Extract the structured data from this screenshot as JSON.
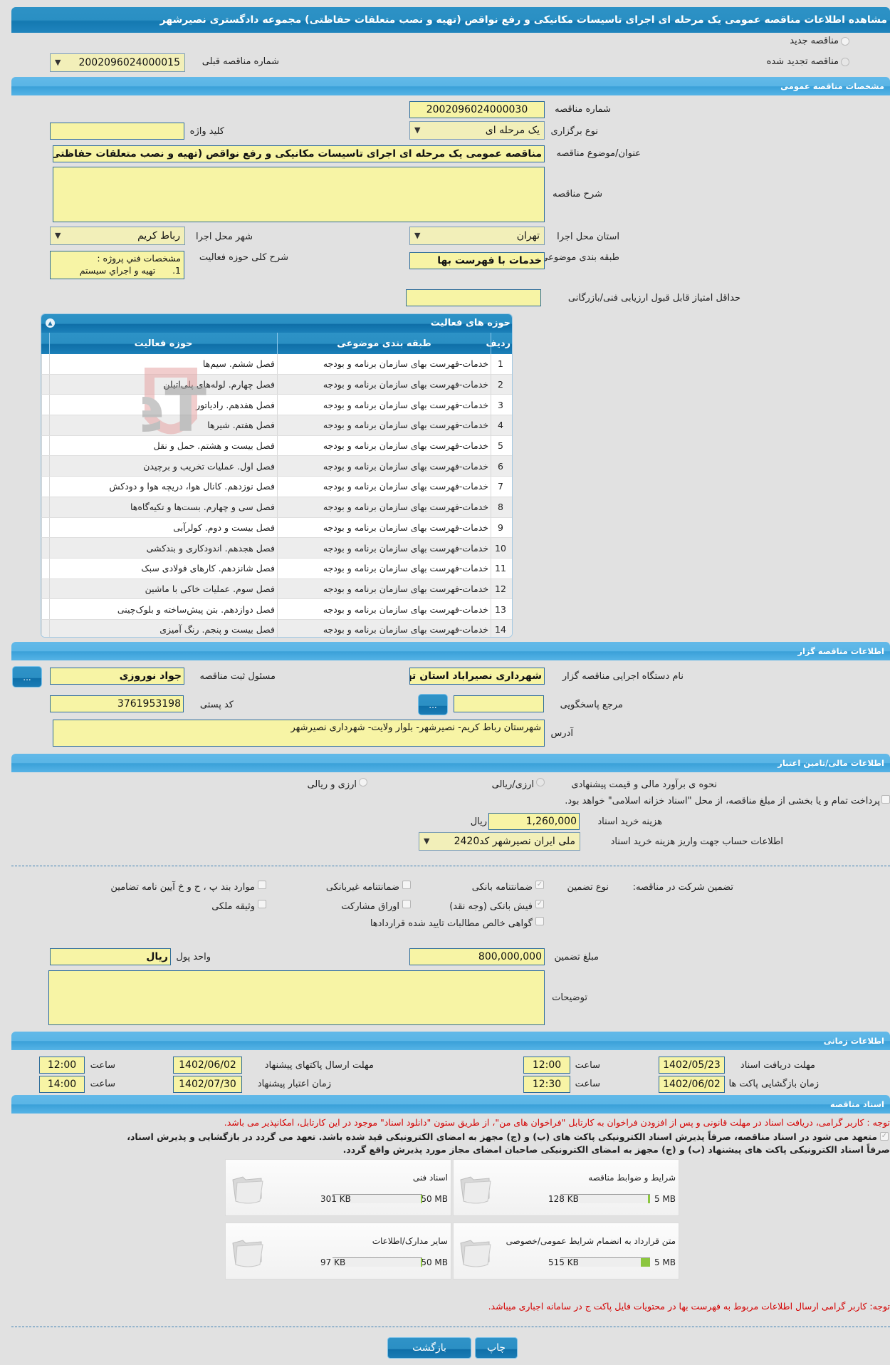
{
  "title": "مشاهده اطلاعات مناقصه عمومی یک مرحله ای اجرای تاسیسات مکانیکی و رفع نواقص (تهیه و نصب متعلقات حفاظتی) مجموعه دادگستری نصیرشهر",
  "tender_type": {
    "new_label": "مناقصه جدید",
    "renewed_label": "مناقصه تجدید شده",
    "previous_number_label": "شماره مناقصه قبلی",
    "previous_number_value": "2002096024000015"
  },
  "general": {
    "section_title": "مشخصات مناقصه عمومی",
    "number_label": "شماره مناقصه",
    "number_value": "2002096024000030",
    "holding_type_label": "نوع برگزاری",
    "holding_type_value": "یک مرحله ای",
    "keyword_label": "کلید واژه",
    "keyword_value": "",
    "subject_label": "عنوان/موضوع مناقصه",
    "subject_value": "مناقصه عمومی یک مرحله ای اجرای تاسیسات مکانیکی و رفع نواقص (تهیه و نصب متعلقات حفاظتی",
    "description_label": "شرح مناقصه",
    "description_value": "",
    "province_label": "استان محل اجرا",
    "province_value": "تهران",
    "city_label": "شهر محل اجرا",
    "city_value": "رباط کریم",
    "category_label": "طبقه بندی موضوعی",
    "category_value": "خدمات با فهرست بها",
    "activity_desc_label": "شرح کلی حوزه فعالیت",
    "activity_desc_line1": "مشخصات فني پروژه :",
    "activity_desc_line2": "1.      تهيه و اجراي سيستم",
    "min_score_label": "حداقل امتیاز قابل قبول ارزیابی فنی/بازرگانی",
    "min_score_value": ""
  },
  "activities": {
    "title": "حوزه های فعالیت",
    "columns": [
      "ردیف",
      "طبقه بندی موضوعی",
      "حوزه فعالیت"
    ],
    "rows": [
      {
        "idx": "1",
        "category": "خدمات-فهرست بهای سازمان برنامه و بودجه",
        "activity": "فصل ششم. سیم‌ها"
      },
      {
        "idx": "2",
        "category": "خدمات-فهرست بهای سازمان برنامه و بودجه",
        "activity": "فصل چهارم. لوله‌های پلی‌اتیلن"
      },
      {
        "idx": "3",
        "category": "خدمات-فهرست بهای سازمان برنامه و بودجه",
        "activity": "فصل هفدهم. رادیاتور"
      },
      {
        "idx": "4",
        "category": "خدمات-فهرست بهای سازمان برنامه و بودجه",
        "activity": "فصل هفتم. شیرها"
      },
      {
        "idx": "5",
        "category": "خدمات-فهرست بهای سازمان برنامه و بودجه",
        "activity": "فصل بیست و هشتم. حمل و نقل"
      },
      {
        "idx": "6",
        "category": "خدمات-فهرست بهای سازمان برنامه و بودجه",
        "activity": "فصل اول. عملیات تخریب و برچیدن"
      },
      {
        "idx": "7",
        "category": "خدمات-فهرست بهای سازمان برنامه و بودجه",
        "activity": "فصل نوزدهم. کانال هوا، دریچه هوا و دودکش"
      },
      {
        "idx": "8",
        "category": "خدمات-فهرست بهای سازمان برنامه و بودجه",
        "activity": "فصل سی و چهارم. بست‌ها و تکیه‌گاه‌ها"
      },
      {
        "idx": "9",
        "category": "خدمات-فهرست بهای سازمان برنامه و بودجه",
        "activity": "فصل بیست و دوم. کولرآبی"
      },
      {
        "idx": "10",
        "category": "خدمات-فهرست بهای سازمان برنامه و بودجه",
        "activity": "فصل هجدهم. اندودکاری و بندکشی"
      },
      {
        "idx": "11",
        "category": "خدمات-فهرست بهای سازمان برنامه و بودجه",
        "activity": "فصل شانزدهم. کارهای فولادی سبک"
      },
      {
        "idx": "12",
        "category": "خدمات-فهرست بهای سازمان برنامه و بودجه",
        "activity": "فصل سوم. عملیات خاکی با ماشین"
      },
      {
        "idx": "13",
        "category": "خدمات-فهرست بهای سازمان برنامه و بودجه",
        "activity": "فصل دوازدهم. بتن پیش‌ساخته و بلوک‌چینی"
      },
      {
        "idx": "14",
        "category": "خدمات-فهرست بهای سازمان برنامه و بودجه",
        "activity": "فصل بیست و پنجم. رنگ آمیزی"
      }
    ]
  },
  "watermark": "AriaTender.neT",
  "organizer": {
    "section_title": "اطلاعات مناقصه گزار",
    "org_label": "نام دستگاه اجرایی مناقصه گزار",
    "org_value": "شهرداری نصیراباد استان تهران",
    "registrar_label": "مسئول ثبت مناقصه",
    "registrar_value": "جواد نوروزی",
    "reference_label": "مرجع پاسخگویی",
    "reference_value": "",
    "postal_label": "کد پستی",
    "postal_value": "3761953198",
    "address_label": "آدرس",
    "address_value": "شهرستان رباط کریم- نصیرشهر- بلوار ولایت- شهرداری نصیرشهر",
    "dots_label": "..."
  },
  "financial": {
    "section_title": "اطلاعات مالی/تامین اعتبار",
    "estimate_label": "نحوه ی برآورد مالی و قیمت پیشنهادی",
    "option_rial": "ارزی/ریالی",
    "option_both": "ارزی و ریالی",
    "treasury_text": "پرداخت تمام و یا بخشی از مبلغ مناقصه، از محل \"اسناد خزانه اسلامی\" خواهد بود.",
    "doc_fee_label": "هزینه خرید اسناد",
    "doc_fee_value": "1,260,000",
    "doc_fee_unit": "ریال",
    "account_label": "اطلاعات حساب جهت واریز هزینه خرید اسناد",
    "account_value": "ملی ایران نصیرشهر کد2420"
  },
  "guarantee": {
    "label": "تضمین شرکت در مناقصه:",
    "type_label": "نوع تضمین",
    "options": [
      {
        "label": "ضمانتنامه بانکی",
        "checked": true
      },
      {
        "label": "ضمانتنامه غیربانکی",
        "checked": false
      },
      {
        "label": "موارد بند پ ، ح و خ آیین نامه تضامین",
        "checked": false
      },
      {
        "label": "فیش بانکی (وجه نقد)",
        "checked": true
      },
      {
        "label": "اوراق مشارکت",
        "checked": false
      },
      {
        "label": "وثیقه ملکی",
        "checked": false
      },
      {
        "label": "گواهی خالص مطالبات تایید شده قراردادها",
        "checked": false
      }
    ],
    "amount_label": "مبلغ تضمین",
    "amount_value": "800,000,000",
    "currency_label": "واحد پول",
    "currency_value": "ریال",
    "notes_label": "توضیحات",
    "notes_value": ""
  },
  "timing": {
    "section_title": "اطلاعات زمانی",
    "doc_receive_label": "مهلت دریافت اسناد",
    "doc_receive_date": "1402/05/23",
    "doc_receive_time": "12:00",
    "submit_label": "مهلت ارسال پاکتهای پیشنهاد",
    "submit_date": "1402/06/02",
    "submit_time": "12:00",
    "opening_label": "زمان بازگشایی پاکت ها",
    "opening_date": "1402/06/02",
    "opening_time": "12:30",
    "validity_label": "زمان اعتبار پیشنهاد",
    "validity_date": "1402/07/30",
    "validity_time": "14:00",
    "time_label": "ساعت"
  },
  "documents": {
    "section_title": "اسناد مناقصه",
    "notice": "توجه : کاربر گرامی، دریافت اسناد در مهلت قانونی و پس از افزودن فراخوان به کارتابل \"فراخوان های من\"، از طریق ستون \"دانلود اسناد\" موجود در این کارتابل، امکانپذیر می باشد.",
    "commitment_line1": "متعهد می شود در اسناد مناقصه، صرفاً پذیرش اسناد الکترونیکی پاکت های (ب) و (ج) مجهز به امضای الکترونیکی قید شده باشد. تعهد می گردد در بازگشایی و پذیرش اسناد،",
    "commitment_line2": "صرفاً اسناد الکترونیکی پاکت های پیشنهاد (ب) و (ج) مجهز به امضای الکترونیکی صاحبان امضای مجاز مورد پذیرش واقع گردد.",
    "items": [
      {
        "name": "شرایط و ضوابط مناقصه",
        "size": "128 KB",
        "max": "5 MB",
        "fill_fraction": 0.025
      },
      {
        "name": "اسناد فنی",
        "size": "301 KB",
        "max": "50 MB",
        "fill_fraction": 0.006
      },
      {
        "name": "متن قرارداد به انضمام شرایط عمومی/خصوصی",
        "size": "515 KB",
        "max": "5 MB",
        "fill_fraction": 0.1
      },
      {
        "name": "سایر مدارک/اطلاعات",
        "size": "97 KB",
        "max": "50 MB",
        "fill_fraction": 0.002
      }
    ],
    "bottom_notice": "توجه: کاربر گرامی ارسال اطلاعات مربوط به فهرست بها در محتویات فایل پاکت ج در سامانه اجباری میباشد."
  },
  "actions": {
    "print_label": "چاپ",
    "back_label": "بازگشت"
  }
}
